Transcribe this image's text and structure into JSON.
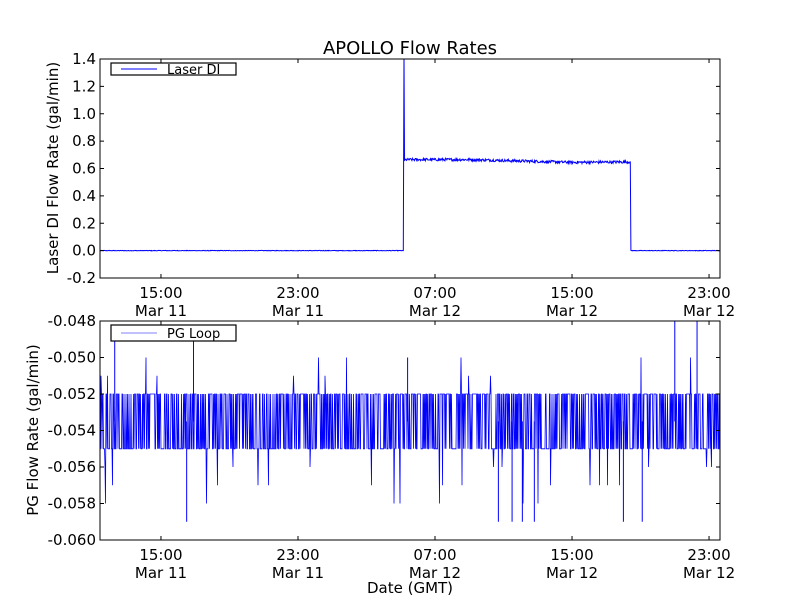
{
  "chart_data": [
    {
      "type": "line",
      "title": "APOLLO Flow Rates",
      "xlabel": "",
      "ylabel": "Laser DI Flow Rate (gal/min)",
      "x_units": "hours since Mar 11 00:00 GMT",
      "xlim": [
        11.44,
        47.64
      ],
      "ylim": [
        -0.2,
        1.4
      ],
      "yticks": [
        -0.2,
        0.0,
        0.2,
        0.4,
        0.6,
        0.8,
        1.0,
        1.2,
        1.4
      ],
      "ytick_labels": [
        "-0.2",
        "0.0",
        "0.2",
        "0.4",
        "0.6",
        "0.8",
        "1.0",
        "1.2",
        "1.4"
      ],
      "xticks": [
        15,
        23,
        31,
        39,
        47
      ],
      "xtick_labels": [
        [
          "15:00",
          "Mar 11"
        ],
        [
          "23:00",
          "Mar 11"
        ],
        [
          "07:00",
          "Mar 12"
        ],
        [
          "15:00",
          "Mar 12"
        ],
        [
          "23:00",
          "Mar 12"
        ]
      ],
      "legend": {
        "entries": [
          "Laser DI"
        ],
        "placement": "upper-left"
      },
      "grid": false,
      "series": [
        {
          "name": "Laser DI",
          "color": "#0000ff",
          "x": [
            11.44,
            29.15,
            29.19,
            29.22,
            29.3,
            33,
            36,
            39,
            42.4,
            42.44,
            47.64
          ],
          "y": [
            0.0,
            0.0,
            1.45,
            0.66,
            0.665,
            0.665,
            0.655,
            0.645,
            0.648,
            0.0,
            0.0
          ],
          "noise_amplitude": 0.02
        }
      ]
    },
    {
      "type": "line",
      "title": "",
      "xlabel": "Date (GMT)",
      "ylabel": "PG Flow Rate (gal/min)",
      "x_units": "hours since Mar 11 00:00 GMT",
      "xlim": [
        11.44,
        47.64
      ],
      "ylim": [
        -0.06,
        -0.048
      ],
      "yticks": [
        -0.06,
        -0.058,
        -0.056,
        -0.054,
        -0.052,
        -0.05,
        -0.048
      ],
      "ytick_labels": [
        "-0.060",
        "-0.058",
        "-0.056",
        "-0.054",
        "-0.052",
        "-0.050",
        "-0.048"
      ],
      "xticks": [
        15,
        23,
        31,
        39,
        47
      ],
      "xtick_labels": [
        [
          "15:00",
          "Mar 11"
        ],
        [
          "23:00",
          "Mar 11"
        ],
        [
          "07:00",
          "Mar 12"
        ],
        [
          "15:00",
          "Mar 12"
        ],
        [
          "23:00",
          "Mar 12"
        ]
      ],
      "legend": {
        "entries": [
          "PG Loop"
        ],
        "placement": "upper-left"
      },
      "grid": false,
      "series": [
        {
          "name": "PG Loop",
          "color": "#0000ff",
          "legend_color": "#8080ff",
          "band": [
            -0.055,
            -0.052
          ],
          "levels": [
            -0.051,
            -0.05,
            -0.056,
            -0.057,
            -0.058
          ],
          "spikes": {
            "x": [
              12.3,
              16.5,
              16.9,
              29.4,
              34.7,
              35.5,
              36.1,
              36.8,
              42.0,
              43.1,
              45.0,
              46.3
            ],
            "y": [
              -0.049,
              -0.059,
              -0.049,
              -0.05,
              -0.059,
              -0.059,
              -0.059,
              -0.059,
              -0.059,
              -0.059,
              -0.048,
              -0.048
            ]
          }
        }
      ]
    }
  ]
}
